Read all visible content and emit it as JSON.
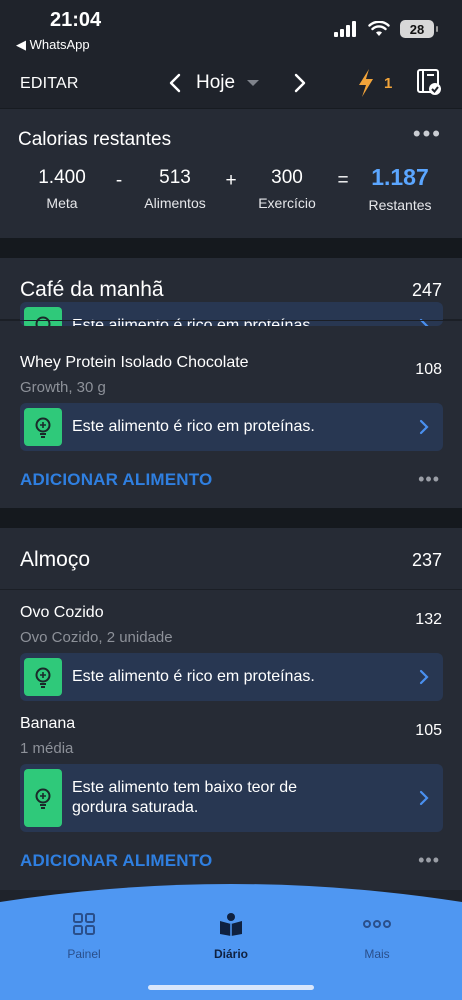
{
  "status_bar": {
    "time": "21:04",
    "back_app": "◀ WhatsApp",
    "battery": "28"
  },
  "nav": {
    "edit_label": "EDITAR",
    "date_label": "Hoje",
    "streak_count": "1"
  },
  "calories": {
    "title": "Calorias restantes",
    "more": "•••",
    "goal_value": "1.400",
    "goal_label": "Meta",
    "op_minus": "-",
    "food_value": "513",
    "food_label": "Alimentos",
    "op_plus": "+",
    "exercise_value": "300",
    "exercise_label": "Exercício",
    "op_equals": "=",
    "remaining_value": "1.187",
    "remaining_label": "Restantes"
  },
  "meals": [
    {
      "name": "Café da manhã",
      "calories": "247",
      "partial_tip": "Este alimento é rico em proteínas.",
      "foods": [
        {
          "name": "Whey Protein Isolado Chocolate",
          "desc": "Growth, 30 g",
          "calories": "108",
          "tip": "Este alimento é rico em proteínas."
        }
      ],
      "add_label": "ADICIONAR ALIMENTO",
      "more": "•••"
    },
    {
      "name": "Almoço",
      "calories": "237",
      "foods": [
        {
          "name": "Ovo Cozido",
          "desc": "Ovo Cozido, 2 unidade",
          "calories": "132",
          "tip": "Este alimento é rico em proteínas."
        },
        {
          "name": "Banana",
          "desc": "1 média",
          "calories": "105",
          "tip_line1": "Este alimento tem baixo teor de",
          "tip_line2": "gordura saturada."
        }
      ],
      "add_label": "ADICIONAR ALIMENTO",
      "more": "•••"
    }
  ],
  "tabs": [
    {
      "label": "Painel",
      "icon": "dashboard-icon"
    },
    {
      "label": "Diário",
      "icon": "diary-icon",
      "active": true
    },
    {
      "label": "Mais",
      "icon": "more-icon"
    }
  ],
  "colors": {
    "background": "#1f232b",
    "card": "#262b35",
    "accent_blue": "#2f7fe0",
    "remaining_blue": "#5ba6ff",
    "tip_bg": "#283752",
    "tip_icon_green": "#2fc97a",
    "streak_orange": "#f2a43a",
    "tabbar_blue": "#4f97f2"
  }
}
